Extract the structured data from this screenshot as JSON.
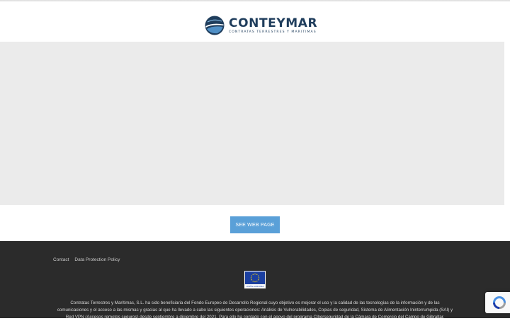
{
  "header": {
    "logo_name": "CONTEYMAR",
    "logo_tagline": "CONTRATAS TERRESTRES Y MARITIMAS"
  },
  "main": {
    "cta_label": "SEE WEB PAGE"
  },
  "footer": {
    "links": [
      "Contact",
      "Data Protection Policy"
    ],
    "eu_caption": "UNIÓN EUROPEA",
    "text": "Contratas Terrestres y Marítimas, S.L. ha sido beneficiaria del Fondo Europeo de Desarrollo Regional cuyo objetivo es mejorar el uso y la calidad de las tecnologías de la información y de las comunicaciones y el acceso a las mismas y gracias al que ha llevado a cabo las siguientes operaciones: Análisis de Vulnerabilidades, Copias de seguridad, Sistema de Alimentación Ininterrumpida (SAI) y Red VPN (Accesos remotos seguros) desde septiembre a diciembre del 2021. Para ello ha contado con el apoyo del programa Ciberseguridad de la Cámara de Comercio del Campo de Gibraltar."
  },
  "colors": {
    "brand_navy": "#1f3d5c",
    "cta_blue": "#5aa0d8",
    "footer_bg": "#2b2b2b",
    "eu_blue": "#1b3fa0"
  },
  "icons": [
    "conteymar-logo-icon",
    "eu-flag-icon",
    "recaptcha-icon"
  ]
}
